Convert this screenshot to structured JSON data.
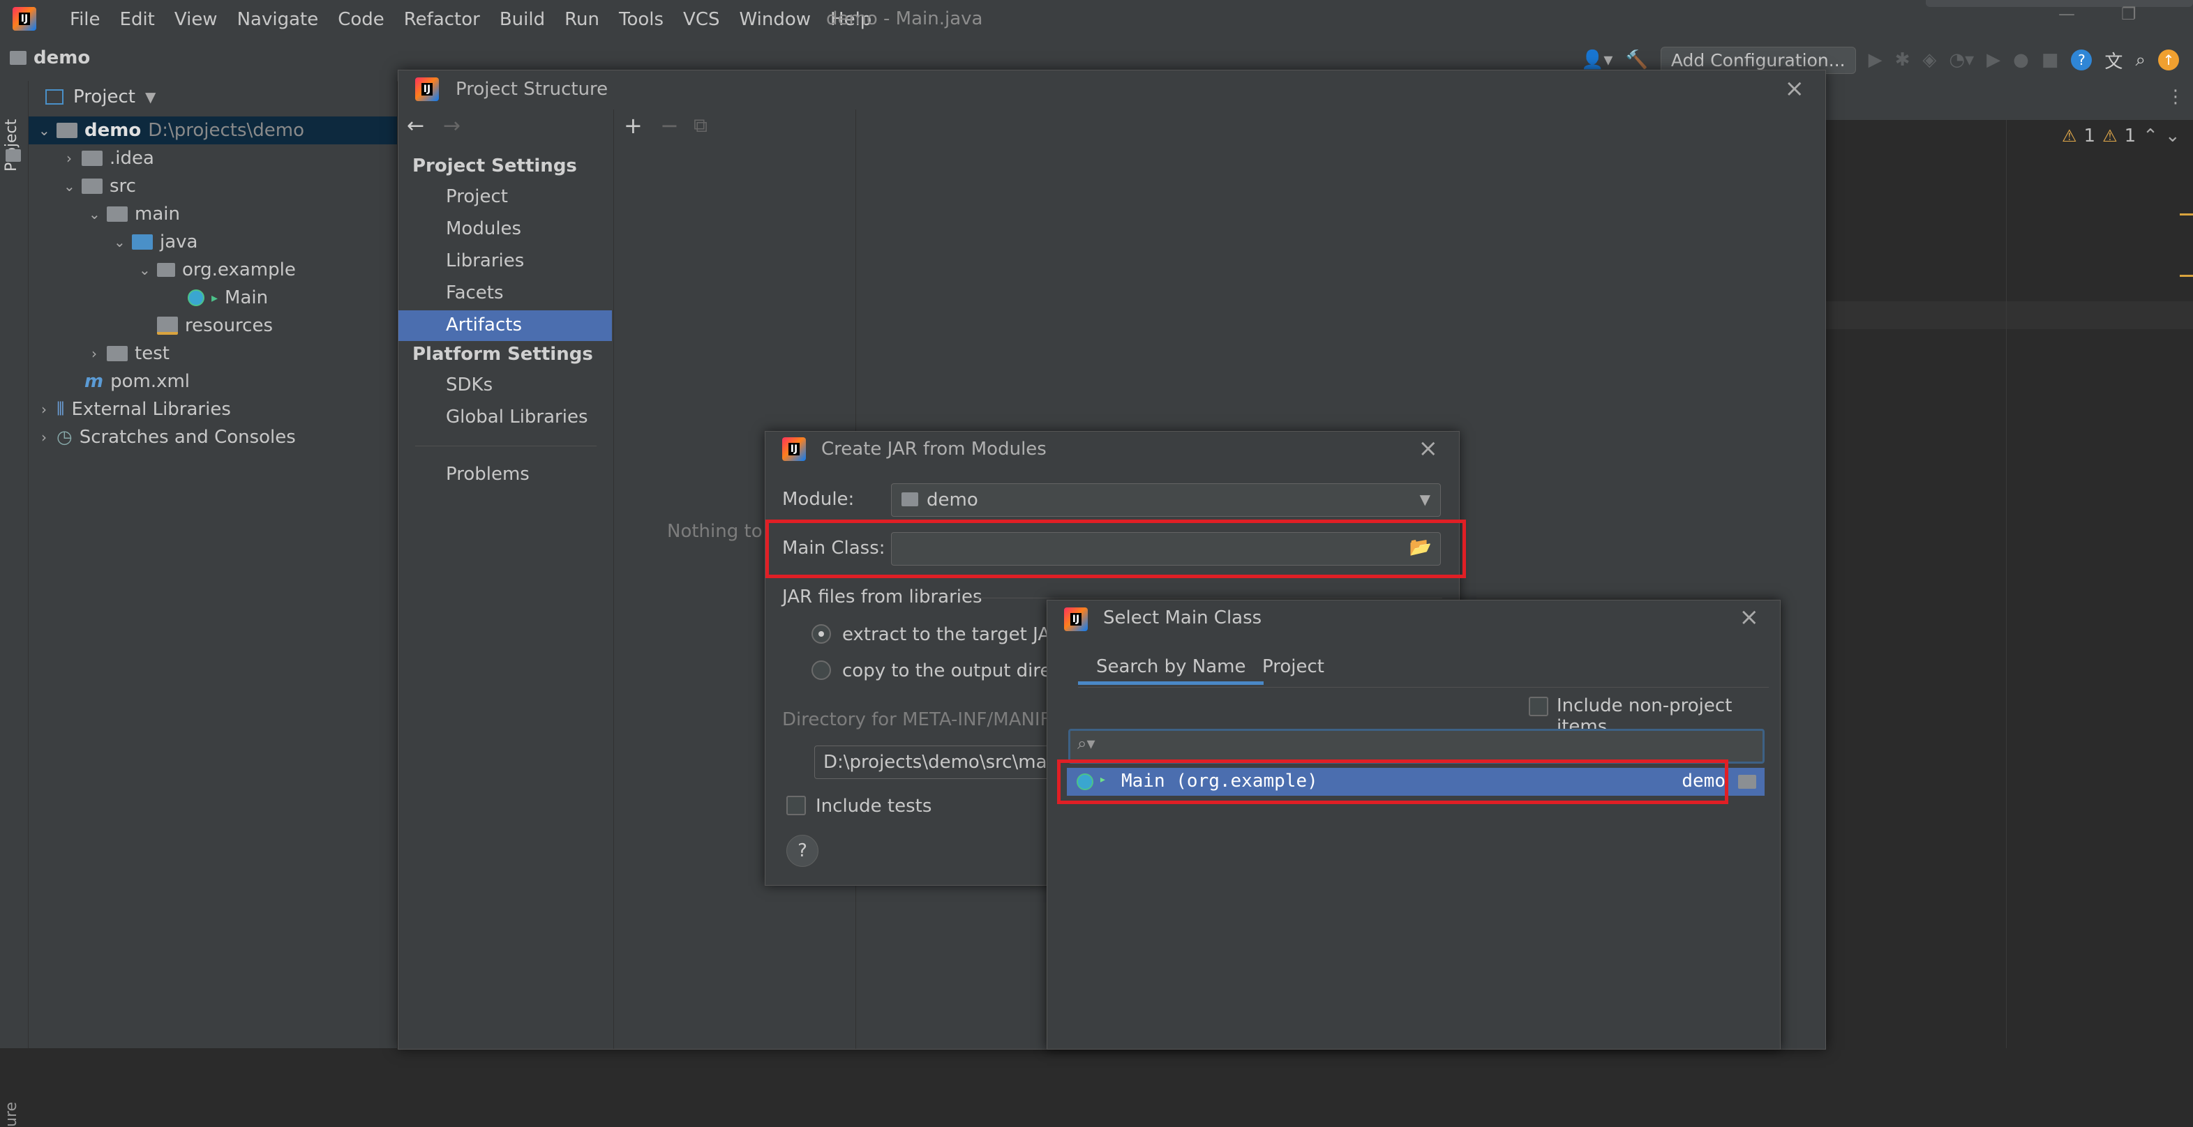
{
  "menubar": {
    "items": [
      "File",
      "Edit",
      "View",
      "Navigate",
      "Code",
      "Refactor",
      "Build",
      "Run",
      "Tools",
      "VCS",
      "Window",
      "Help"
    ],
    "title": "demo - Main.java"
  },
  "navbar": {
    "project": "demo",
    "add_config": "Add Configuration..."
  },
  "toolstrip": {
    "project_label": "Project",
    "structure_label": "ure"
  },
  "project_panel": {
    "header": "Project",
    "tree": [
      {
        "label": "demo",
        "extra": "D:\\projects\\demo"
      },
      {
        "label": ".idea"
      },
      {
        "label": "src"
      },
      {
        "label": "main"
      },
      {
        "label": "java"
      },
      {
        "label": "org.example"
      },
      {
        "label": "Main"
      },
      {
        "label": "resources"
      },
      {
        "label": "test"
      },
      {
        "label": "pom.xml"
      },
      {
        "label": "External Libraries"
      },
      {
        "label": "Scratches and Consoles"
      }
    ]
  },
  "editor": {
    "warn1": "1",
    "warn2": "1"
  },
  "project_structure": {
    "title": "Project Structure",
    "project_settings": "Project Settings",
    "items_project": [
      "Project",
      "Modules",
      "Libraries",
      "Facets",
      "Artifacts"
    ],
    "platform_settings": "Platform Settings",
    "items_platform": [
      "SDKs",
      "Global Libraries"
    ],
    "problems": "Problems",
    "nothing": "Nothing to s"
  },
  "create_jar": {
    "title": "Create JAR from Modules",
    "module_label": "Module:",
    "module_value": "demo",
    "main_class_label": "Main Class:",
    "main_class_value": "",
    "jar_files": "JAR files from libraries",
    "opt_extract": "extract to the target JAR",
    "opt_copy": "copy to the output directo",
    "manifest_label": "Directory for META-INF/MANIFES",
    "manifest_value": "D:\\projects\\demo\\src\\main\\j",
    "include_tests": "Include tests",
    "help": "?"
  },
  "select_main": {
    "title": "Select Main Class",
    "tab_search": "Search by Name",
    "tab_project": "Project",
    "include_nonproject": "Include non-project items",
    "search_value": "",
    "result": {
      "name": "Main (org.example)",
      "module": "demo"
    }
  }
}
